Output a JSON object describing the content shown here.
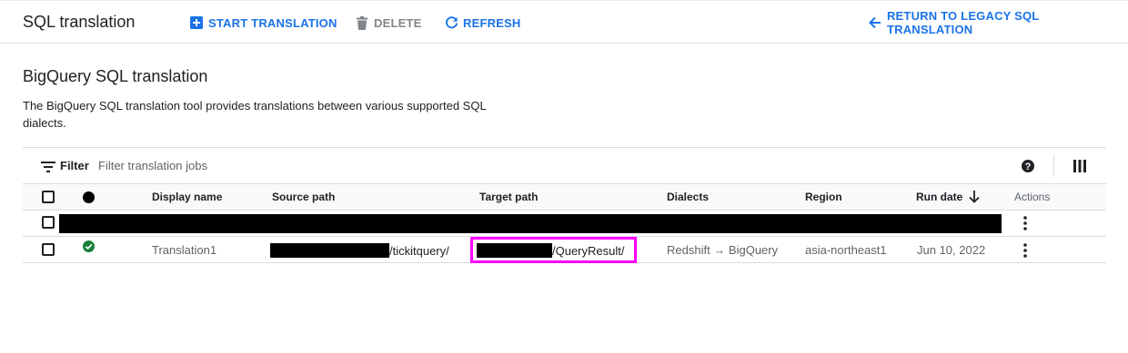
{
  "topbar": {
    "title": "SQL translation",
    "start_label": "START TRANSLATION",
    "delete_label": "DELETE",
    "refresh_label": "REFRESH",
    "return_label": "RETURN TO LEGACY SQL TRANSLATION"
  },
  "main": {
    "title": "BigQuery SQL translation",
    "description": "The BigQuery SQL translation tool provides translations between various supported SQL dialects."
  },
  "filter": {
    "label": "Filter",
    "placeholder": "Filter translation jobs"
  },
  "table": {
    "columns": {
      "display_name": "Display name",
      "source_path": "Source path",
      "target_path": "Target path",
      "dialects": "Dialects",
      "region": "Region",
      "run_date": "Run date",
      "actions": "Actions"
    },
    "rows": [
      {
        "display_name": "Translation1",
        "source_path_suffix": "/tickitquery/",
        "target_path_suffix": "/QueryResult/",
        "dialects": "Redshift → BigQuery",
        "region": "asia-northeast1",
        "run_date": "Jun 10, 2022",
        "status": "succeeded"
      }
    ]
  },
  "colors": {
    "accent": "#1a73e8",
    "success": "#188038",
    "highlight": "#ff00ff"
  }
}
